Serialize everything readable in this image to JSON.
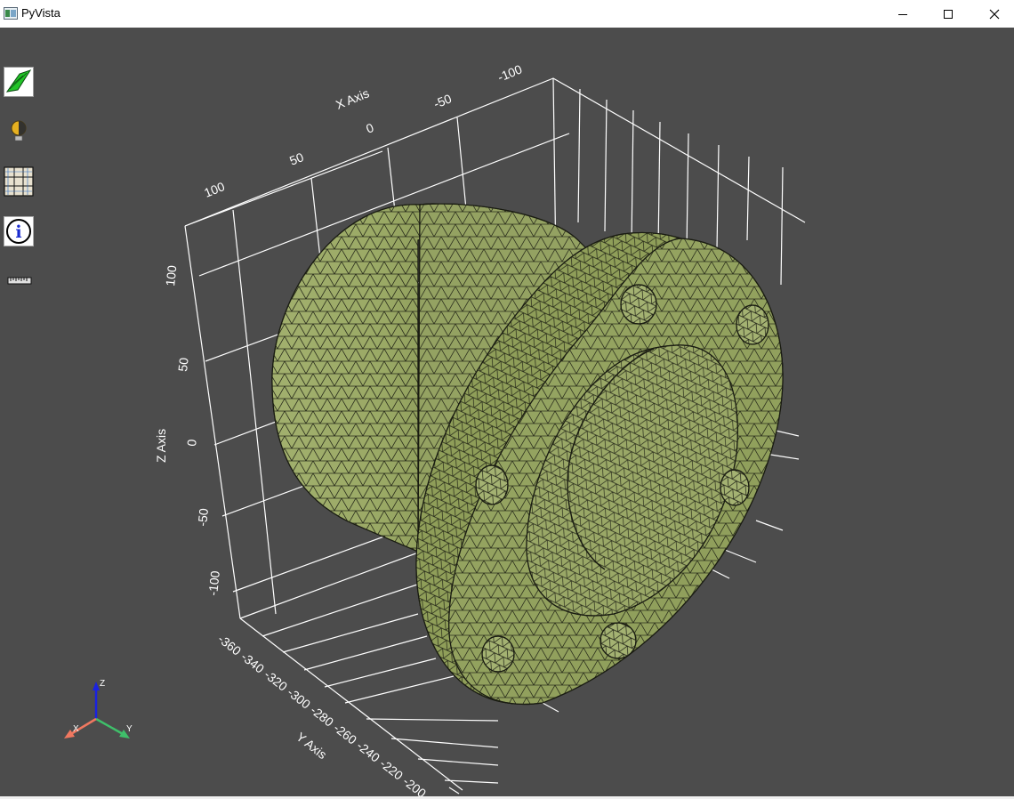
{
  "window": {
    "title": "PyVista"
  },
  "toolbar": {
    "tools": [
      {
        "name": "mesh-display-tool-icon"
      },
      {
        "name": "light-tool-icon"
      },
      {
        "name": "grid-view-tool-icon"
      },
      {
        "name": "info-tool-icon"
      },
      {
        "name": "ruler-tool-icon"
      }
    ]
  },
  "axes": {
    "x_title": "X Axis",
    "y_title": "Y Axis",
    "z_title": "Z Axis",
    "x_ticks": [
      "-100",
      "-50",
      "0",
      "50",
      "100"
    ],
    "y_ticks": [
      "-360",
      "-340",
      "-320",
      "-300",
      "-280",
      "-260",
      "-240",
      "-220",
      "-200"
    ],
    "z_ticks": [
      "100",
      "50",
      "0",
      "-50",
      "-100"
    ]
  },
  "orientation_widget": {
    "x": "X",
    "y": "Y",
    "z": "Z"
  },
  "colors": {
    "background": "#4c4c4c",
    "mesh_fill": "#95a463",
    "mesh_edge": "#1a1c12",
    "grid": "#ffffff"
  }
}
